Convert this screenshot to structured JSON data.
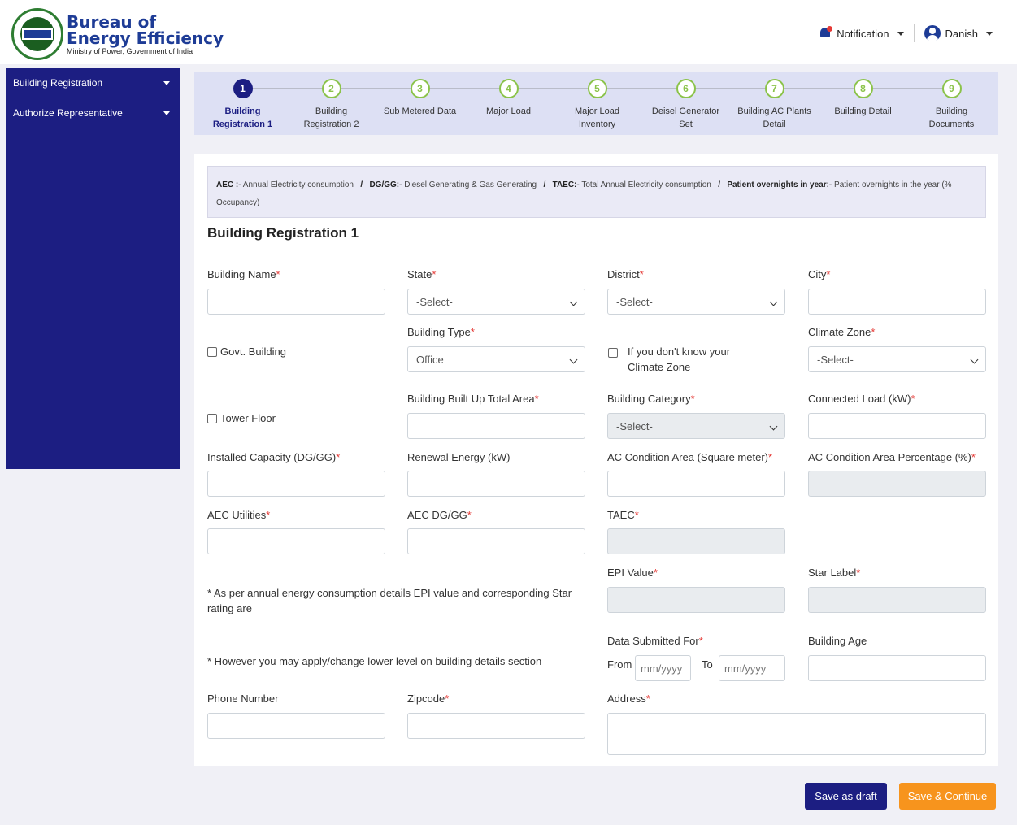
{
  "header": {
    "logo_line1": "Bureau of",
    "logo_line2": "Energy Efficiency",
    "logo_line3": "Ministry of Power, Government of India",
    "notification_label": "Notification",
    "user_label": "Danish"
  },
  "sidebar": {
    "items": [
      {
        "label": "Building Registration"
      },
      {
        "label": "Authorize Representative"
      }
    ]
  },
  "stepper": {
    "steps": [
      {
        "num": "1",
        "label": "Building Registration 1"
      },
      {
        "num": "2",
        "label": "Building Registration 2"
      },
      {
        "num": "3",
        "label": "Sub Metered Data"
      },
      {
        "num": "4",
        "label": "Major Load"
      },
      {
        "num": "5",
        "label": "Major Load Inventory"
      },
      {
        "num": "6",
        "label": "Deisel Generator Set"
      },
      {
        "num": "7",
        "label": "Building AC Plants Detail"
      },
      {
        "num": "8",
        "label": "Building Detail"
      },
      {
        "num": "9",
        "label": "Building Documents"
      }
    ],
    "active_step": "1"
  },
  "legend": {
    "aec_key": "AEC :-",
    "aec_val": "Annual Electricity consumption",
    "dg_key": "DG/GG:-",
    "dg_val": "Diesel Generating & Gas Generating",
    "taec_key": "TAEC:-",
    "taec_val": "Total Annual Electricity consumption",
    "po_key": "Patient overnights in year:-",
    "po_val": "Patient overnights in the year (% Occupancy)",
    "sep": "/"
  },
  "form": {
    "title": "Building Registration 1",
    "building_name_label": "Building Name",
    "state_label": "State",
    "state_value": "-Select-",
    "district_label": "District",
    "district_value": "-Select-",
    "city_label": "City",
    "govt_building_label": "Govt. Building",
    "building_type_label": "Building Type",
    "building_type_value": "Office",
    "climate_unknown_label": "If you don't know your Climate Zone",
    "climate_zone_label": "Climate Zone",
    "climate_zone_value": "-Select-",
    "tower_floor_label": "Tower Floor",
    "built_up_area_label": "Building Built Up Total Area",
    "building_category_label": "Building Category",
    "building_category_value": "-Select-",
    "connected_load_label": "Connected Load (kW)",
    "installed_capacity_label": "Installed Capacity (DG/GG)",
    "renewable_energy_label": "Renewal Energy (kW)",
    "ac_area_label": "AC Condition Area (Square meter)",
    "ac_pct_label": "AC Condition Area Percentage (%)",
    "aec_utilities_label": "AEC Utilities",
    "aec_dg_label": "AEC DG/GG",
    "taec_label": "TAEC",
    "epi_label": "EPI Value",
    "star_label": "Star Label",
    "note1": "* As per annual energy consumption details EPI value and corresponding Star rating are",
    "note2": "* However you may apply/change lower level on building details section",
    "data_submitted_label": "Data Submitted For",
    "from_label": "From",
    "to_label": "To",
    "date_placeholder": "mm/yyyy",
    "building_age_label": "Building Age",
    "phone_label": "Phone Number",
    "zipcode_label": "Zipcode",
    "address_label": "Address",
    "required_mark": "*"
  },
  "actions": {
    "save_draft": "Save as draft",
    "save_continue": "Save & Continue"
  },
  "colors": {
    "brand": "#1c1e82",
    "accent": "#f7941d",
    "required": "#e53935",
    "step_done": "#8bc34a"
  }
}
